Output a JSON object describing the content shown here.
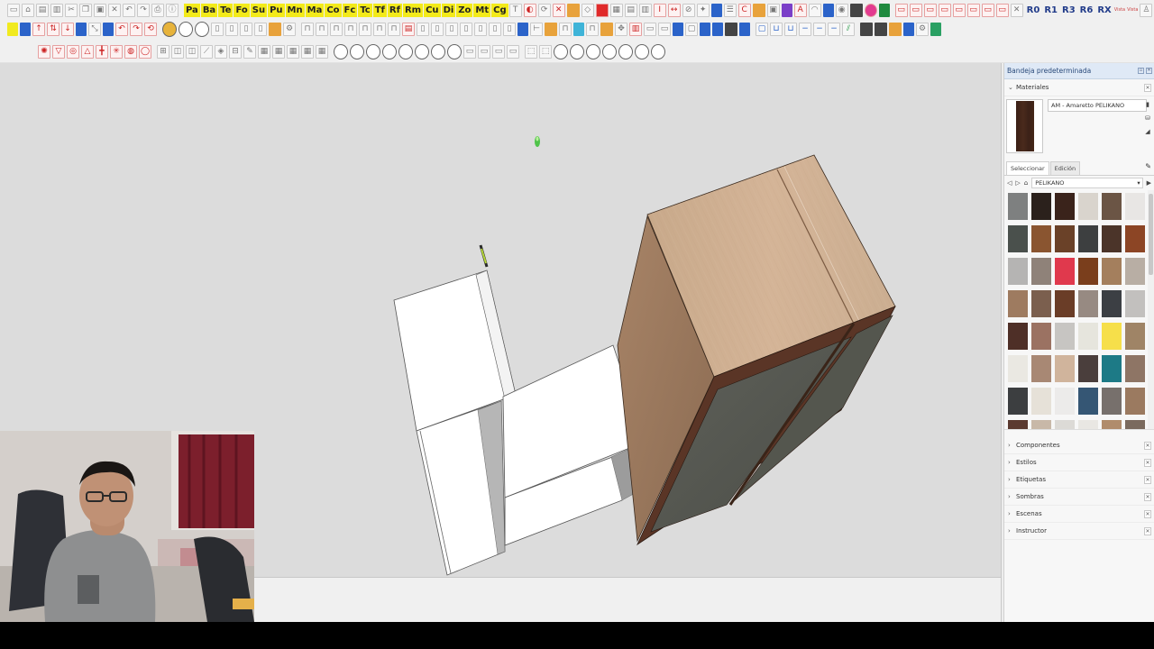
{
  "tray": {
    "title": "Bandeja predeterminada",
    "materials": {
      "header": "Materiales",
      "current_material": "AM - Amaretto PELIKANO",
      "current_color": "#3d2219",
      "tab_select": "Seleccionar",
      "tab_edit": "Edición",
      "library": "PELIKANO",
      "swatches": [
        "#7e8080",
        "#2b211c",
        "#3a231b",
        "#d9d4cd",
        "#6b5545",
        "#e8e6e4",
        "#4a504c",
        "#8a5530",
        "#6a4128",
        "#3d3f40",
        "#4b3429",
        "#8c4525",
        "#b5b4b3",
        "#8f8279",
        "#e0394d",
        "#7a3e1c",
        "#a47f5d",
        "#b8aea4",
        "#9e7b60",
        "#7b5f4e",
        "#6a3d27",
        "#978a82",
        "#3c3f44",
        "#c2c0be",
        "#4e2f27",
        "#9b7262",
        "#c7c5c2",
        "#e6e5dd",
        "#f6df4a",
        "#9f8466",
        "#eae8e2",
        "#a88874",
        "#d0b49c",
        "#4a3e3c",
        "#1d7a86",
        "#8e7565",
        "#3c3e40",
        "#e6e1d8",
        "#ecebea",
        "#355674",
        "#77706c",
        "#9b7a60",
        "#5b3a30",
        "#c8b8a8",
        "#dcdad6",
        "#e9e7e3",
        "#b08c6c",
        "#7a6a5e"
      ]
    },
    "panels": [
      "Componentes",
      "Estilos",
      "Etiquetas",
      "Sombras",
      "Escenas",
      "Instructor"
    ]
  },
  "toolbar": {
    "row1_labels": [
      "Pa",
      "Ba",
      "Te",
      "Fo",
      "Su",
      "Pu",
      "Mn",
      "Ma",
      "Co",
      "Fc",
      "Tc",
      "Tf",
      "Rf",
      "Rm",
      "Cu",
      "Di",
      "Zo",
      "Mt",
      "Cg"
    ],
    "row1_right": [
      "R0",
      "R1",
      "R3",
      "R6",
      "RX"
    ],
    "small_labels": [
      "Vista",
      "Vista"
    ],
    "x_mark": "T"
  },
  "viewport": {
    "background": "#dcdcdc",
    "wood_color": "#c7a789",
    "edge_color": "#5a3526",
    "panel_dark": "#56574f"
  }
}
